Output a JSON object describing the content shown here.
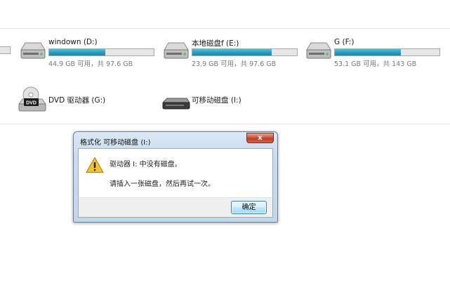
{
  "drives": [
    {
      "name": "windown (D:)",
      "free_text": "44.9 GB 可用，共 97.6 GB",
      "used_fraction": 0.54
    },
    {
      "name": "本地磁盘f (E:)",
      "free_text": "23.9 GB 可用，共 97.6 GB",
      "used_fraction": 0.76
    },
    {
      "name": "G (F:)",
      "free_text": "53.1 GB 可用，共 143 GB",
      "used_fraction": 0.63
    }
  ],
  "devices": [
    {
      "name": "DVD 驱动器 (G:)",
      "badge": "DVD"
    },
    {
      "name": "可移动磁盘 (I:)"
    }
  ],
  "dialog": {
    "title": "格式化 可移动磁盘 (I:)",
    "close_label": "x",
    "message": "驱动器 I: 中没有磁盘。",
    "detail": "请插入一张磁盘，然后再试一次。",
    "ok_label": "确定"
  },
  "colors": {
    "bar_fill": "#2a9bbd",
    "bar_track": "#e6e6e6",
    "close_button": "#c13b23",
    "warning": "#f3c332"
  }
}
